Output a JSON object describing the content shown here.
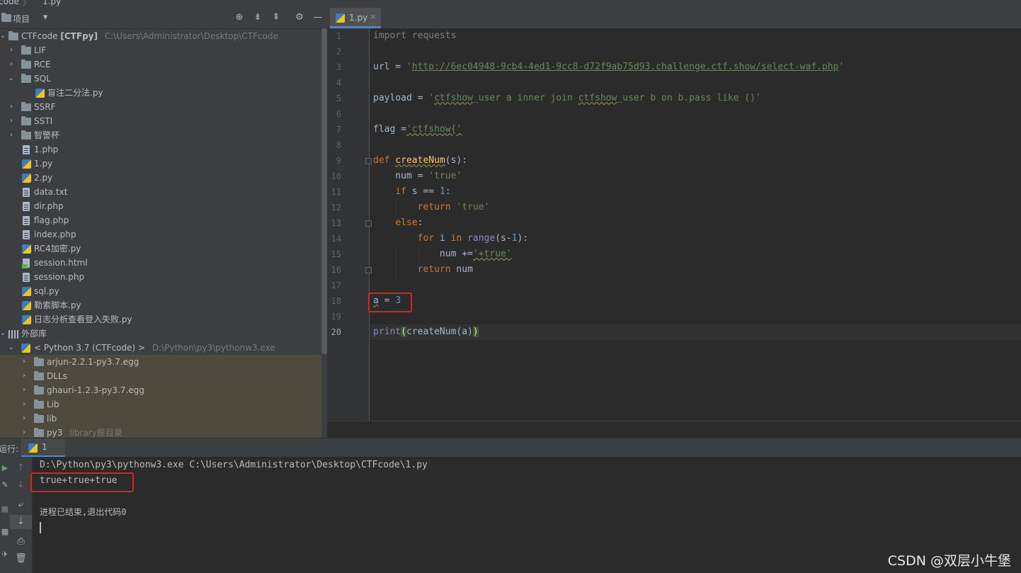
{
  "breadcrumb": {
    "root": "code",
    "sep": "〉",
    "file": "1.py"
  },
  "project_panel": {
    "title": "项目",
    "dropdown_icon": "chevron-down-icon",
    "header_icons": [
      "locate-icon",
      "expand-all-icon",
      "collapse-all-icon",
      "gear-icon",
      "minimize-icon"
    ],
    "root": {
      "name": "CTFcode",
      "module": "[CTFpy]",
      "path": "C:\\Users\\Administrator\\Desktop\\CTFcode"
    },
    "items": [
      {
        "label": "LIF",
        "type": "folder",
        "expanded": false
      },
      {
        "label": "RCE",
        "type": "folder",
        "expanded": false
      },
      {
        "label": "SQL",
        "type": "folder",
        "expanded": true
      },
      {
        "label": "盲注二分法.py",
        "type": "py"
      },
      {
        "label": "SSRF",
        "type": "folder",
        "expanded": false
      },
      {
        "label": "SSTI",
        "type": "folder",
        "expanded": false
      },
      {
        "label": "智警杯",
        "type": "folder",
        "expanded": false
      },
      {
        "label": "1.php",
        "type": "file"
      },
      {
        "label": "1.py",
        "type": "py"
      },
      {
        "label": "2.py",
        "type": "py"
      },
      {
        "label": "data.txt",
        "type": "file"
      },
      {
        "label": "dir.php",
        "type": "file"
      },
      {
        "label": "flag.php",
        "type": "file"
      },
      {
        "label": "index.php",
        "type": "file"
      },
      {
        "label": "RC4加密.py",
        "type": "py"
      },
      {
        "label": "session.html",
        "type": "html"
      },
      {
        "label": "session.php",
        "type": "file"
      },
      {
        "label": "sql.py",
        "type": "py"
      },
      {
        "label": "勒索脚本.py",
        "type": "py"
      },
      {
        "label": "日志分析查看登入失败.py",
        "type": "py"
      }
    ],
    "external": {
      "label": "外部库"
    },
    "python_sdk": {
      "label": "< Python 3.7 (CTFcode) >",
      "path": "D:\\Python\\py3\\pythonw3.exe"
    },
    "lib_items": [
      {
        "label": "arjun-2.2.1-py3.7.egg",
        "note": ""
      },
      {
        "label": "DLLs",
        "note": ""
      },
      {
        "label": "ghauri-1.2.3-py3.7.egg",
        "note": ""
      },
      {
        "label": "Lib",
        "note": ""
      },
      {
        "label": "lib",
        "note": ""
      },
      {
        "label": "py3",
        "note": "library根目录"
      }
    ]
  },
  "editor": {
    "tab": {
      "label": "1.py",
      "close": "×"
    },
    "line_numbers": [
      "1",
      "2",
      "3",
      "4",
      "5",
      "6",
      "7",
      "8",
      "9",
      "10",
      "11",
      "12",
      "13",
      "14",
      "15",
      "16",
      "17",
      "18",
      "19",
      "20"
    ],
    "code": {
      "l1": "import requests",
      "l3_var": "url",
      "l3_op": " = ",
      "l3_q1": "'",
      "l3_url": "http://6ec04948-9cb4-4ed1-9cc8-d72f9ab75d93.challenge.ctf.show/select-waf.php",
      "l3_q2": "'",
      "l5_var": "payload",
      "l5_op": " = ",
      "l5_str_a": "'",
      "l5_str_b": "ctfshow",
      "l5_str_c": "_user a inner join ",
      "l5_str_d": "ctfshow",
      "l5_str_e": "_user b on b.pass like ()'",
      "l7_var": "flag",
      "l7_op": " =",
      "l7_str": "'ctfshow{'",
      "l9_kw": "def",
      "l9_fn": "createNum",
      "l9_rest": "(s):",
      "l10_a": "    num = ",
      "l10_str": "'true'",
      "l11_kw": "if",
      "l11_a": " s == ",
      "l11_num": "1",
      "l11_b": ":",
      "l12_kw": "return",
      "l12_str": "'true'",
      "l13_kw": "else",
      "l13_b": ":",
      "l14_kw": "for",
      "l14_a": " i ",
      "l14_kw2": "in",
      "l14_bi": "range",
      "l14_b": "(s-",
      "l14_num": "1",
      "l14_c": "):",
      "l15_a": "num +=",
      "l15_str": "'+true'",
      "l16_kw": "return",
      "l16_a": " num",
      "l18_a": "a",
      "l18_b": " = ",
      "l18_num": "3",
      "l20_bi": "print",
      "l20_p1": "(",
      "l20_a": "createNum(a)",
      "l20_p2": ")"
    }
  },
  "run_panel": {
    "label": "运行:",
    "tab": "1",
    "command": "D:\\Python\\py3\\pythonw3.exe C:\\Users\\Administrator\\Desktop\\CTFcode\\1.py",
    "output": "true+true+true",
    "exit": "进程已结束,退出代码0",
    "tools": [
      "up-arrow-icon",
      "down-arrow-icon",
      "wrap-icon",
      "scroll-to-end-icon",
      "print-icon",
      "trash-icon"
    ],
    "left_tools": [
      "run-icon",
      "wrench-icon",
      "stop-icon",
      "layout-icon",
      "pin-icon"
    ]
  },
  "watermark": "CSDN @双层小牛堡",
  "colors": {
    "highlight_box": "#e0201c",
    "tab_accent": "#4a88c7",
    "keyword": "#cc7832",
    "string": "#6a8759",
    "number": "#6897bb"
  }
}
